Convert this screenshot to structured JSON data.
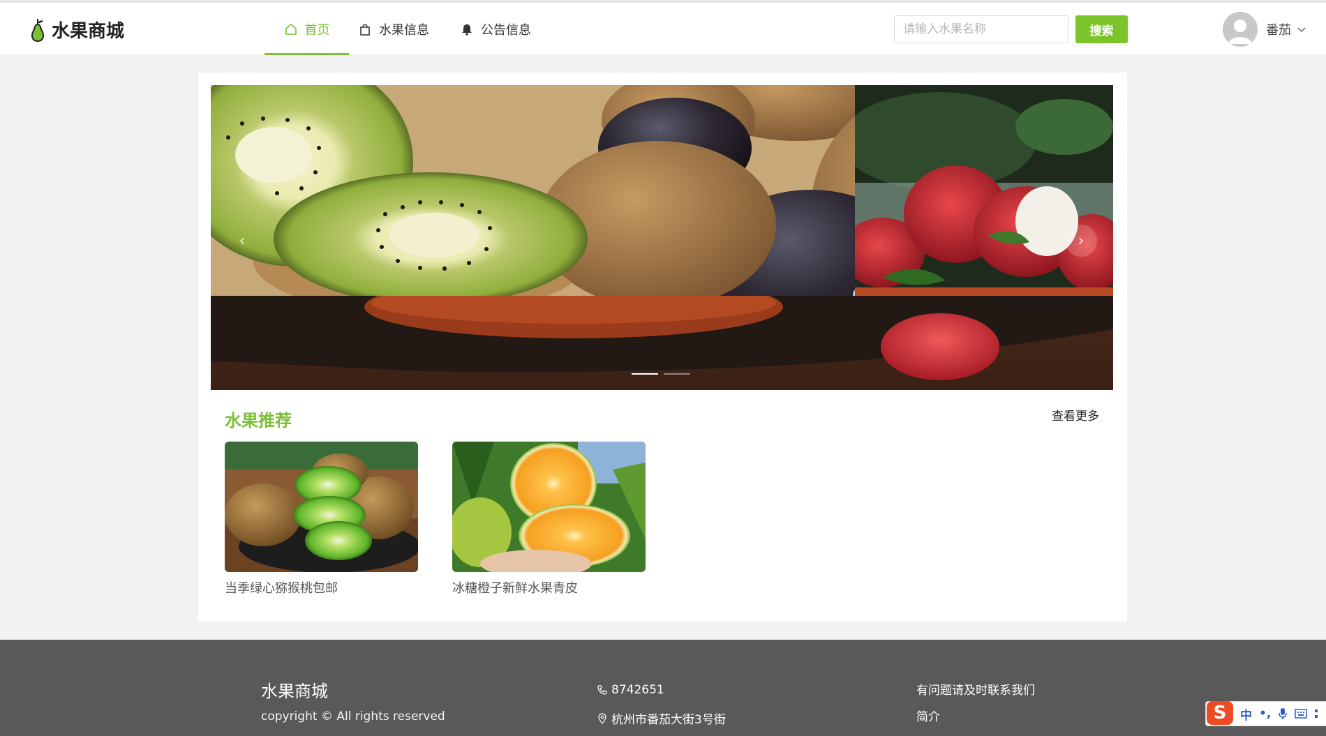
{
  "header": {
    "logo_text": "水果商城",
    "nav": [
      {
        "label": "首页",
        "icon": "home-icon",
        "active": true
      },
      {
        "label": "水果信息",
        "icon": "shopping-bag-icon",
        "active": false
      },
      {
        "label": "公告信息",
        "icon": "bell-icon",
        "active": false
      }
    ],
    "search": {
      "placeholder": "请输入水果名称",
      "value": "",
      "button_label": "搜索"
    },
    "user": {
      "name": "番茄"
    }
  },
  "carousel": {
    "slides": [
      "kiwi-plum-banner",
      "lychee-banner"
    ],
    "prev_symbol": "‹",
    "next_symbol": "›",
    "active_index": 0,
    "indicator_count": 2
  },
  "recommend": {
    "title": "水果推荐",
    "more_label": "查看更多",
    "products": [
      {
        "name": "当季绿心猕猴桃包邮",
        "image": "kiwi-image"
      },
      {
        "name": "冰糖橙子新鲜水果青皮",
        "image": "orange-image"
      }
    ]
  },
  "footer": {
    "title": "水果商城",
    "copyright": "copyright © All rights reserved",
    "phone": "8742651",
    "address": "杭州市番茄大街3号街",
    "contact": "有问题请及时联系我们",
    "intro": "简介"
  },
  "ime": {
    "lang": "中",
    "punct": "•,"
  },
  "colors": {
    "accent": "#7bbf35",
    "button": "#7bc42b",
    "footer_bg": "#595959",
    "page_bg": "#f2f2f2"
  }
}
